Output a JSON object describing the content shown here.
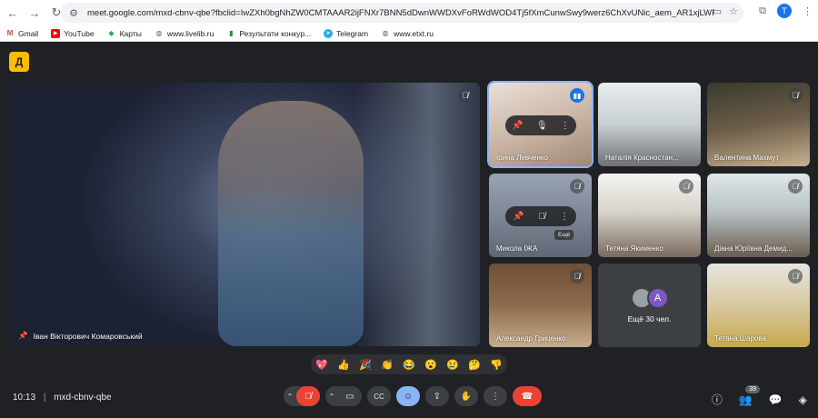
{
  "browser": {
    "url": "meet.google.com/mxd-cbnv-qbe?fbclid=IwZXh0bgNhZW0CMTAAAR2ijFNXr7BNN5dDwnWWDXvFoRWdWOD4Tj5fXmCunwSwy9werz6ChXvUNic_aem_AR1xjLWFAJnBV3gEn3Q4ReuCh7Rq_...",
    "profile_initial": "T",
    "bookmarks": [
      {
        "label": "Gmail",
        "icon": "gmail-icon"
      },
      {
        "label": "YouTube",
        "icon": "youtube-icon"
      },
      {
        "label": "Карты",
        "icon": "maps-icon"
      },
      {
        "label": "www.livelib.ru",
        "icon": "globe-icon"
      },
      {
        "label": "Результати конкур...",
        "icon": "bookmark-icon"
      },
      {
        "label": "Telegram",
        "icon": "telegram-icon"
      },
      {
        "label": "www.etxt.ru",
        "icon": "globe-icon"
      }
    ]
  },
  "meet": {
    "main_speaker": "Іван Вікторович Комаровський",
    "tiles": [
      {
        "name": "Ірина Левченко",
        "state": "speaking",
        "active": true
      },
      {
        "name": "Наталія Красностан...",
        "state": "none"
      },
      {
        "name": "Валентина Махмут",
        "state": "muted"
      },
      {
        "name": "Микола ІЖА",
        "state": "muted"
      },
      {
        "name": "Тетяна Якименко",
        "state": "muted"
      },
      {
        "name": "Діана Юріївна Демид...",
        "state": "muted"
      },
      {
        "name": "Александр Гриценко",
        "state": "muted"
      },
      {
        "name": "Ещё 30 чел.",
        "state": "more"
      },
      {
        "name": "Тетяна Шарова",
        "state": "muted"
      }
    ],
    "more_avatar_letter": "A",
    "tooltip": "Ещё",
    "reactions": [
      "💖",
      "👍",
      "🎉",
      "👏",
      "😂",
      "😮",
      "😢",
      "🤔",
      "👎"
    ],
    "time": "10:13",
    "meeting_code": "mxd-cbnv-qbe",
    "participants_count": "39",
    "colors": {
      "end_call": "#ea4335",
      "accent": "#8ab4f8",
      "speaking": "#1a73e8",
      "logo": "#fbbc04"
    }
  }
}
